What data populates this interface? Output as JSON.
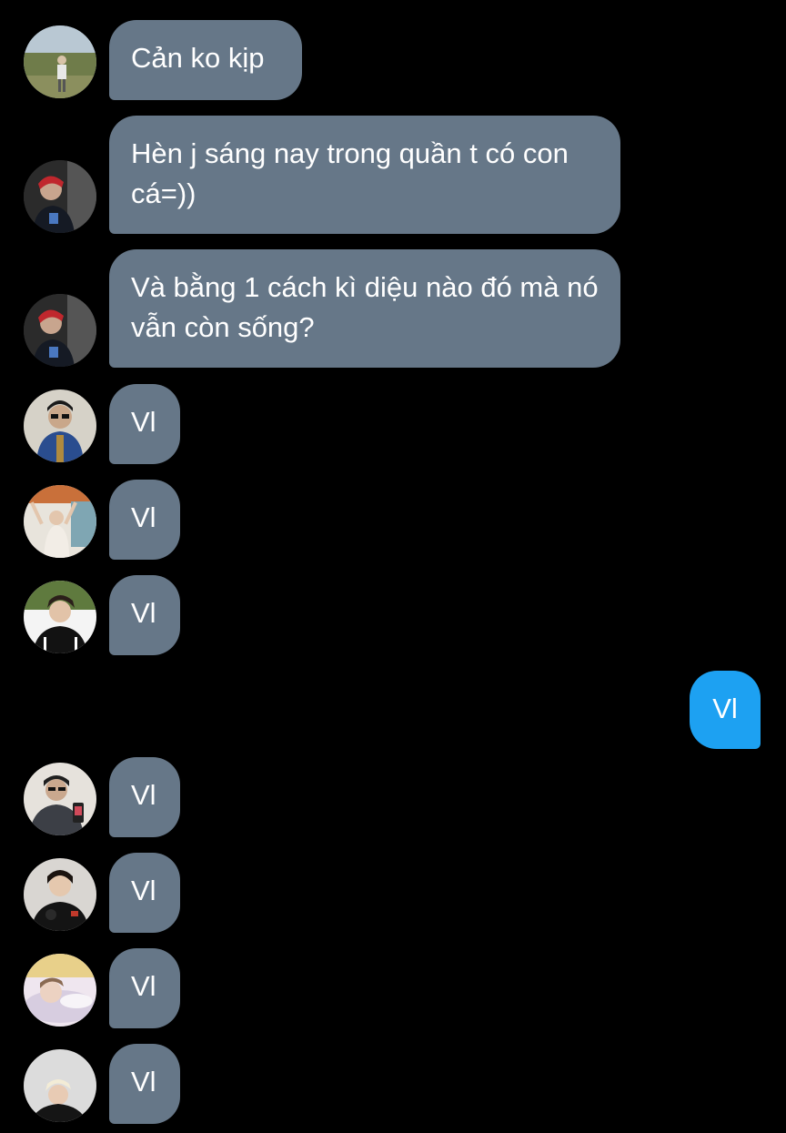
{
  "colors": {
    "background": "#000000",
    "incoming_bubble": "#667788",
    "outgoing_bubble": "#1da1f2",
    "text": "#ffffff"
  },
  "messages": [
    {
      "direction": "incoming",
      "text": "Cản ko kịp",
      "avatar": "avatar-landscape-standing"
    },
    {
      "direction": "incoming",
      "text": "Hèn j sáng nay trong quần t có con cá=))",
      "avatar": "avatar-red-hair"
    },
    {
      "direction": "incoming",
      "text": "Và bằng 1 cách kì diệu nào đó mà nó vẫn còn sống?",
      "avatar": "avatar-red-hair"
    },
    {
      "direction": "incoming",
      "text": "Vl",
      "avatar": "avatar-sunglasses-denim"
    },
    {
      "direction": "incoming",
      "text": "Vl",
      "avatar": "avatar-arms-raised"
    },
    {
      "direction": "incoming",
      "text": "Vl",
      "avatar": "avatar-dark-jacket"
    },
    {
      "direction": "outgoing",
      "text": "Vl"
    },
    {
      "direction": "incoming",
      "text": "Vl",
      "avatar": "avatar-phone-selfie"
    },
    {
      "direction": "incoming",
      "text": "Vl",
      "avatar": "avatar-black-outfit"
    },
    {
      "direction": "incoming",
      "text": "Vl",
      "avatar": "avatar-lying-down"
    },
    {
      "direction": "incoming",
      "text": "Vl",
      "avatar": "avatar-blonde-hair"
    }
  ]
}
